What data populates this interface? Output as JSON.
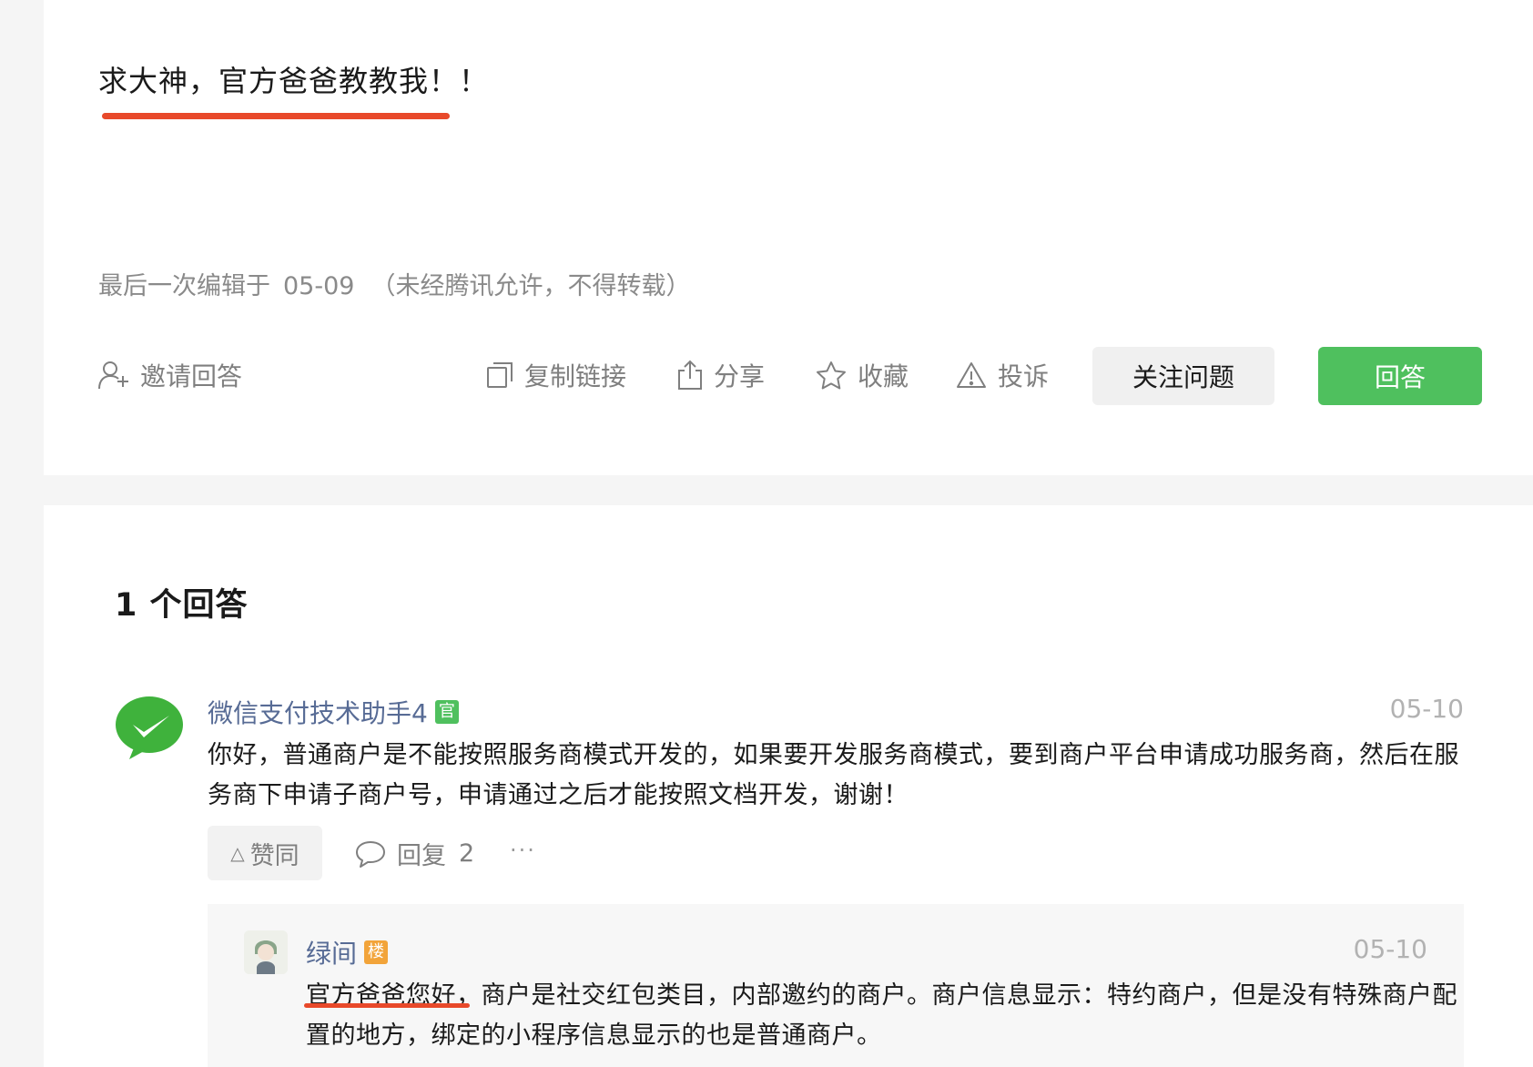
{
  "question": {
    "title": "求大神，官方爸爸教教我！！",
    "edit_prefix": "最后一次编辑于",
    "edit_date": "05-09",
    "edit_note": "（未经腾讯允许，不得转载）",
    "actions": {
      "invite": "邀请回答",
      "copy_link": "复制链接",
      "share": "分享",
      "favorite": "收藏",
      "report": "投诉"
    },
    "follow_button": "关注问题",
    "answer_button": "回答"
  },
  "answers_header": "1 个回答",
  "answer": {
    "author": "微信支付技术助手4",
    "badge": "官",
    "date": "05-10",
    "body": "你好，普通商户是不能按照服务商模式开发的，如果要开发服务商模式，要到商户平台申请成功服务商，然后在服务商下申请子商户号，申请通过之后才能按照文档开发，谢谢！",
    "like_label": "赞同",
    "reply_label": "回复",
    "reply_count": "2",
    "more_label": "···"
  },
  "reply": {
    "author": "绿间",
    "badge": "楼",
    "date": "05-10",
    "body": "官方爸爸您好，商户是社交红包类目，内部邀约的商户。商户信息显示：特约商户，但是没有特殊商户配置的地方，绑定的小程序信息显示的也是普通商户。"
  },
  "colors": {
    "accent_green": "#4fc05e",
    "link_blue": "#576b95",
    "highlight_red": "#e8492a",
    "floor_badge": "#f2a43a"
  },
  "icons": [
    "add-user-icon",
    "copy-icon",
    "share-icon",
    "star-icon",
    "warning-icon",
    "comment-icon",
    "wechat-pay-logo-icon",
    "avatar-user"
  ]
}
